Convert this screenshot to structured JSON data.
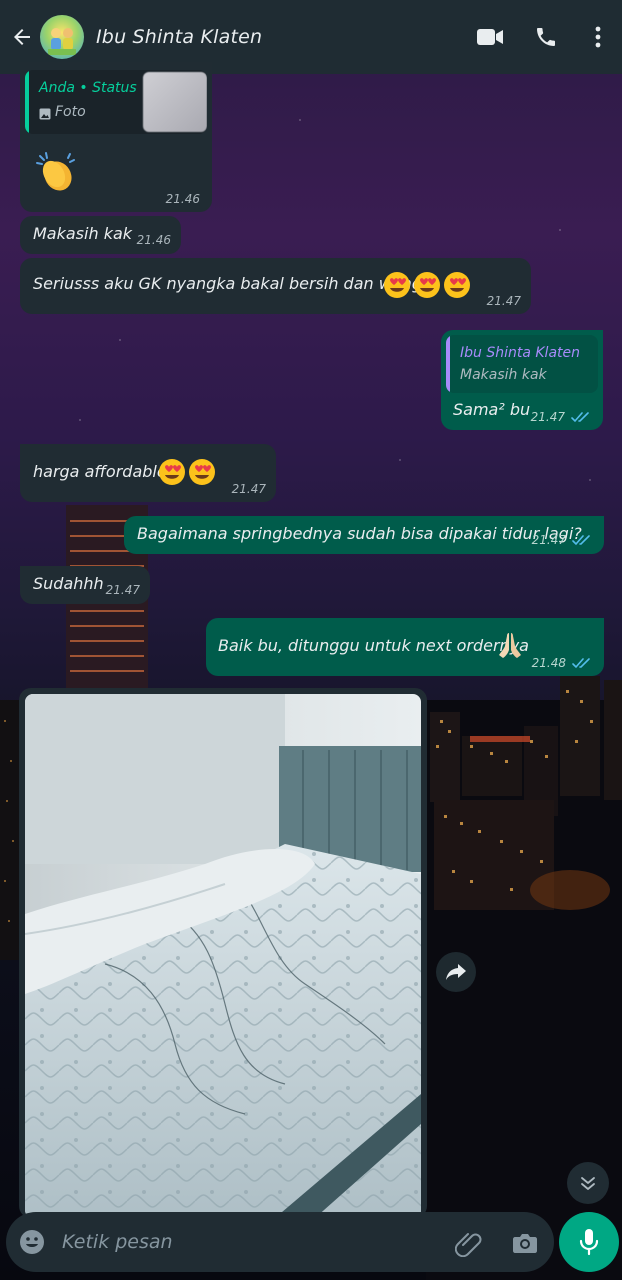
{
  "header": {
    "contact_name": "Ibu Shinta Klaten"
  },
  "messages": [
    {
      "direction": "incoming",
      "quote_author": "Anda • Status",
      "quote_text": "Foto",
      "emoji": "clapping-hands",
      "time": "21.46"
    },
    {
      "direction": "incoming",
      "text": "Makasih kak",
      "time": "21.46"
    },
    {
      "direction": "incoming",
      "text": "Seriusss aku GK nyangka bakal bersih dan wangi",
      "emoji": "heart-eyes x3",
      "time": "21.47"
    },
    {
      "direction": "outgoing",
      "quote_author": "Ibu Shinta Klaten",
      "quote_text": "Makasih kak",
      "text": "Sama² bu",
      "time": "21.47",
      "status": "read"
    },
    {
      "direction": "incoming",
      "text": "harga affordable",
      "emoji": "heart-eyes x2",
      "time": "21.47"
    },
    {
      "direction": "outgoing",
      "text": "Bagaimana springbednya sudah bisa dipakai tidur lagi?",
      "time": "21.47",
      "status": "read"
    },
    {
      "direction": "incoming",
      "text": "Sudahhh",
      "time": "21.47"
    },
    {
      "direction": "outgoing",
      "text": "Baik bu, ditunggu untuk next ordernya",
      "emoji": "folded-hands",
      "time": "21.48",
      "status": "read"
    },
    {
      "direction": "incoming",
      "type": "image",
      "caption": ""
    }
  ],
  "composer": {
    "placeholder": "Ketik pesan"
  },
  "colors": {
    "header_bg": "#1f2c33",
    "incoming_bubble": "#202c33",
    "outgoing_bubble": "#005c4b",
    "accent": "#00a884",
    "read_ticks": "#53bdeb"
  }
}
